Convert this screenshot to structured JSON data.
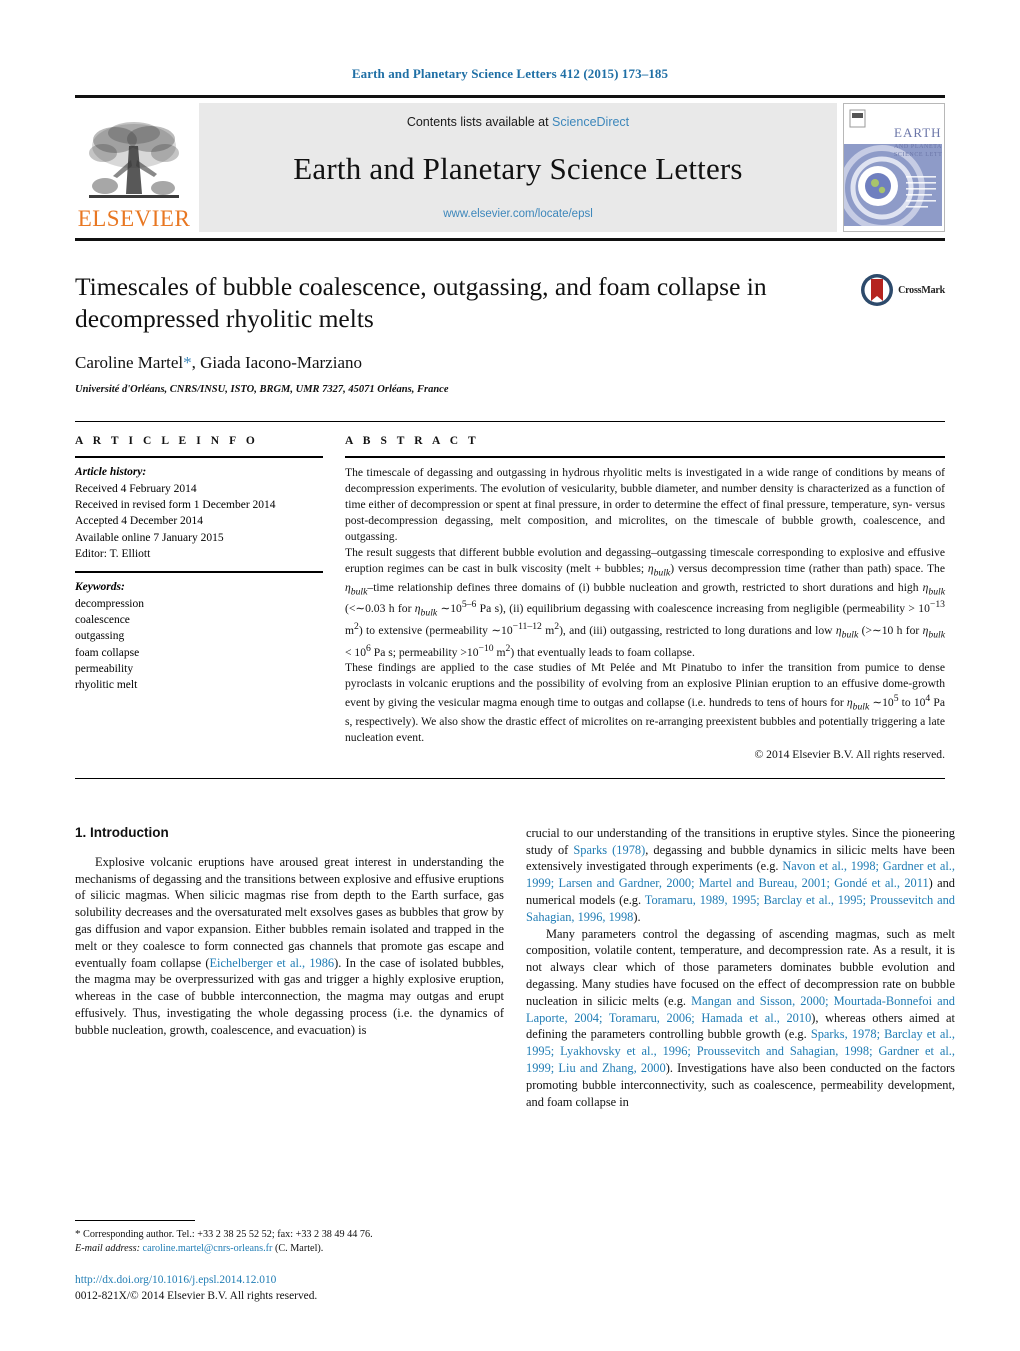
{
  "running_head": "Earth and Planetary Science Letters 412 (2015) 173–185",
  "masthead": {
    "publisher_name": "ELSEVIER",
    "contents_prefix": "Contents lists available at ",
    "contents_link": "ScienceDirect",
    "journal_name": "Earth and Planetary Science Letters",
    "journal_url": "www.elsevier.com/locate/epsl",
    "cover_title_line1": "EARTH",
    "cover_title_line2": "AND PLANETARY",
    "cover_title_line3": "SCIENCE LETTERS",
    "link_color": "#3d87bb",
    "elsevier_orange": "#E87722"
  },
  "article": {
    "title": "Timescales of bubble coalescence, outgassing, and foam collapse in decompressed rhyolitic melts",
    "authors_part1": "Caroline Martel",
    "authors_star": "*",
    "authors_part2": ", Giada Iacono-Marziano",
    "affiliation": "Université d'Orléans, CNRS/INSU, ISTO, BRGM, UMR 7327, 45071 Orléans, France",
    "crossmark_label": "CrossMark"
  },
  "article_info": {
    "heading": "A R T I C L E   I N F O",
    "history_label": "Article history:",
    "history": [
      "Received 4 February 2014",
      "Received in revised form 1 December 2014",
      "Accepted 4 December 2014",
      "Available online 7 January 2015",
      "Editor: T. Elliott"
    ],
    "keywords_label": "Keywords:",
    "keywords": [
      "decompression",
      "coalescence",
      "outgassing",
      "foam collapse",
      "permeability",
      "rhyolitic melt"
    ]
  },
  "abstract": {
    "heading": "A B S T R A C T",
    "paragraph1": "The timescale of degassing and outgassing in hydrous rhyolitic melts is investigated in a wide range of conditions by means of decompression experiments. The evolution of vesicularity, bubble diameter, and number density is characterized as a function of time either of decompression or spent at final pressure, in order to determine the effect of final pressure, temperature, syn- versus post-decompression degassing, melt composition, and microlites, on the timescale of bubble growth, coalescence, and outgassing.",
    "paragraph2_html": "The result suggests that different bubble evolution and degassing–outgassing timescale corresponding to explosive and effusive eruption regimes can be cast in bulk viscosity (melt + bubbles; <i>η<sub>bulk</sub></i>) versus decompression time (rather than path) space. The <i>η<sub>bulk</sub></i>–time relationship defines three domains of (i) bubble nucleation and growth, restricted to short durations and high <i>η<sub>bulk</sub></i> (&lt;∼0.03 h for <i>η<sub>bulk</sub></i> ∼10<sup>5–6</sup> Pa s), (ii) equilibrium degassing with coalescence increasing from negligible (permeability &gt; 10<sup>−13</sup> m<sup>2</sup>) to extensive (permeability ∼10<sup>−11–12</sup> m<sup>2</sup>), and (iii) outgassing, restricted to long durations and low <i>η<sub>bulk</sub></i> (&gt;∼10 h for <i>η<sub>bulk</sub></i> &lt; 10<sup>6</sup> Pa s; permeability &gt;10<sup>−10</sup> m<sup>2</sup>) that eventually leads to foam collapse.",
    "paragraph3_html": "These findings are applied to the case studies of Mt Pelée and Mt Pinatubo to infer the transition from pumice to dense pyroclasts in volcanic eruptions and the possibility of evolving from an explosive Plinian eruption to an effusive dome-growth event by giving the vesicular magma enough time to outgas and collapse (i.e. hundreds to tens of hours for <i>η<sub>bulk</sub></i> ∼10<sup>5</sup> to 10<sup>4</sup> Pa s, respectively). We also show the drastic effect of microlites on re-arranging preexistent bubbles and potentially triggering a late nucleation event.",
    "copyright": "© 2014 Elsevier B.V. All rights reserved."
  },
  "introduction": {
    "heading": "1. Introduction",
    "left_p1_html": "Explosive volcanic eruptions have aroused great interest in understanding the mechanisms of degassing and the transitions between explosive and effusive eruptions of silicic magmas. When silicic magmas rise from depth to the Earth surface, gas solubility decreases and the oversaturated melt exsolves gases as bubbles that grow by gas diffusion and vapor expansion. Either bubbles remain isolated and trapped in the melt or they coalesce to form connected gas channels that promote gas escape and eventually foam collapse (<a class=\"ref\">Eichelberger et al., 1986</a>). In the case of isolated bubbles, the magma may be overpressurized with gas and trigger a highly explosive eruption, whereas in the case of bubble interconnection, the magma may outgas and erupt effusively. Thus, investigating the whole degassing process (i.e. the dynamics of bubble nucleation, growth, coalescence, and evacuation) is",
    "right_p1_html": "crucial to our understanding of the transitions in eruptive styles. Since the pioneering study of <a class=\"ref\">Sparks (1978)</a>, degassing and bubble dynamics in silicic melts have been extensively investigated through experiments (e.g. <a class=\"ref\">Navon et al., 1998; Gardner et al., 1999; Larsen and Gardner, 2000; Martel and Bureau, 2001; Gondé et al., 2011</a>) and numerical models (e.g. <a class=\"ref\">Toramaru, 1989, 1995; Barclay et al., 1995; Proussevitch and Sahagian, 1996, 1998</a>).",
    "right_p2_html": "Many parameters control the degassing of ascending magmas, such as melt composition, volatile content, temperature, and decompression rate. As a result, it is not always clear which of those parameters dominates bubble evolution and degassing. Many studies have focused on the effect of decompression rate on bubble nucleation in silicic melts (e.g. <a class=\"ref\">Mangan and Sisson, 2000; Mourtada-Bonnefoi and Laporte, 2004; Toramaru, 2006; Hamada et al., 2010</a>), whereas others aimed at defining the parameters controlling bubble growth (e.g. <a class=\"ref\">Sparks, 1978; Barclay et al., 1995; Lyakhovsky et al., 1996; Proussevitch and Sahagian, 1998; Gardner et al., 1999; Liu and Zhang, 2000</a>). Investigations have also been conducted on the factors promoting bubble interconnectivity, such as coalescence, permeability development, and foam collapse in"
  },
  "footnote": {
    "star": "*",
    "corresponding_html": "Corresponding author. Tel.: +33 2 38 25 52 52; fax: +33 2 38 49 44 76.",
    "email_label": "E-mail address:",
    "email": "caroline.martel@cnrs-orleans.fr",
    "email_suffix": "(C. Martel).",
    "doi": "http://dx.doi.org/10.1016/j.epsl.2014.12.010",
    "issn_line": "0012-821X/© 2014 Elsevier B.V. All rights reserved."
  }
}
